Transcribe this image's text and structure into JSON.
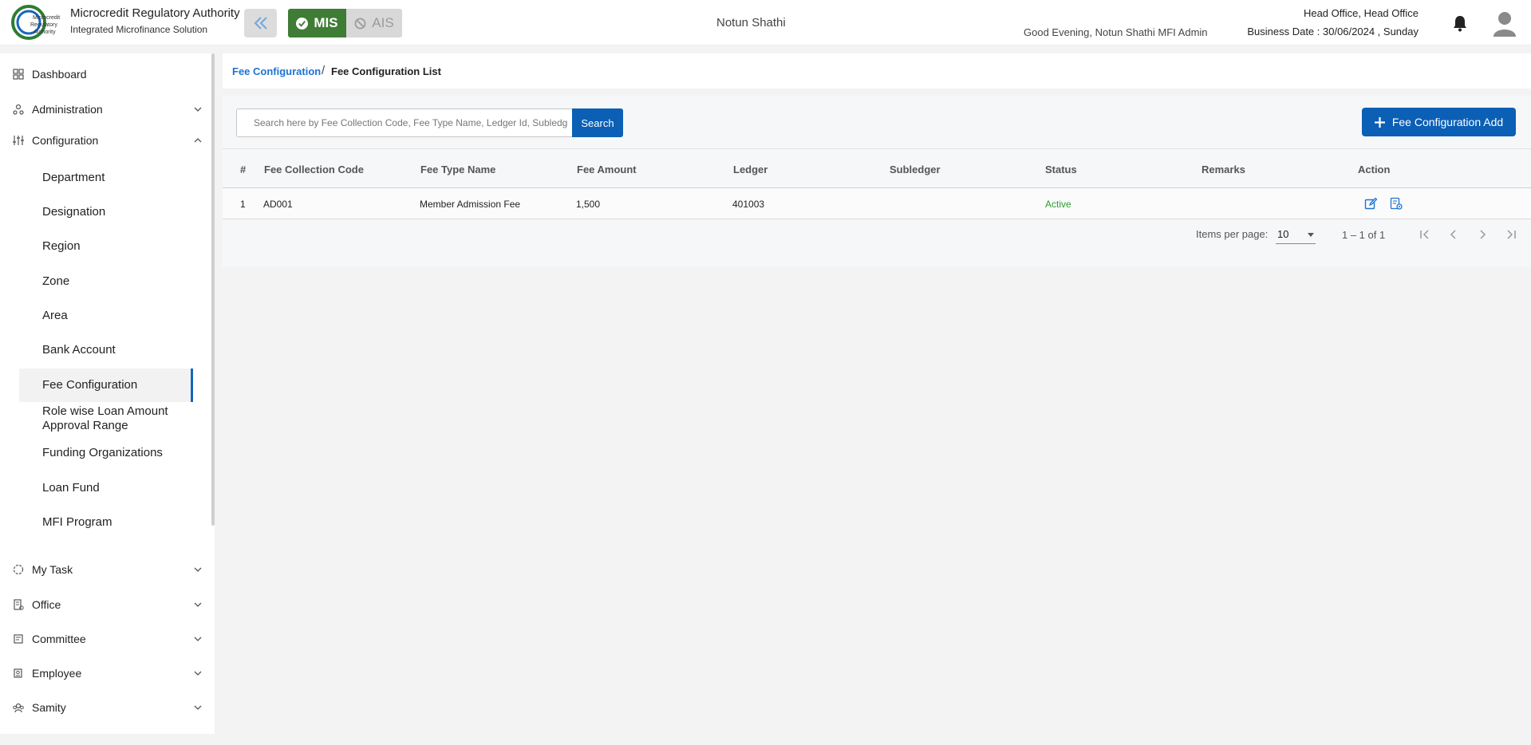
{
  "header": {
    "brand_title": "Microcredit Regulatory Authority",
    "brand_subtitle": "Integrated Microfinance Solution",
    "logo_text": "Microcredit Regulatory Authority",
    "mis_label": "MIS",
    "ais_label": "AIS",
    "organization": "Notun Shathi",
    "greeting": "Good Evening, Notun Shathi MFI Admin",
    "office": "Head Office, Head Office",
    "business_date": "Business Date : 30/06/2024 , Sunday",
    "accent": "#3f7c35"
  },
  "sidebar": {
    "items": [
      {
        "label": "Dashboard",
        "icon": "grid-icon"
      },
      {
        "label": "Administration",
        "icon": "users-icon",
        "expanded": false
      },
      {
        "label": "Configuration",
        "icon": "sliders-icon",
        "expanded": true
      },
      {
        "label": "My Task",
        "icon": "task-icon",
        "expanded": false
      },
      {
        "label": "Office",
        "icon": "office-icon",
        "expanded": false
      },
      {
        "label": "Committee",
        "icon": "committee-icon",
        "expanded": false
      },
      {
        "label": "Employee",
        "icon": "employee-icon",
        "expanded": false
      },
      {
        "label": "Samity",
        "icon": "samity-icon",
        "expanded": false
      }
    ],
    "config_items": [
      "Department",
      "Designation",
      "Region",
      "Zone",
      "Area",
      "Bank Account",
      "Fee Configuration",
      "Role wise Loan Amount Approval Range",
      "Funding Organizations",
      "Loan Fund",
      "MFI Program"
    ],
    "active": "Fee Configuration"
  },
  "breadcrumb": {
    "parent": "Fee Configuration",
    "separator": "/",
    "current": "Fee Configuration List"
  },
  "search": {
    "placeholder": "Search here by Fee Collection Code, Fee Type Name, Ledger Id, Subledger",
    "button_label": "Search"
  },
  "add_button_label": "Fee Configuration Add",
  "table": {
    "columns": [
      "#",
      "Fee Collection Code",
      "Fee Type Name",
      "Fee Amount",
      "Ledger",
      "Subledger",
      "Status",
      "Remarks",
      "Action"
    ],
    "rows": [
      {
        "index": "1",
        "code": "AD001",
        "fee_type": "Member Admission Fee",
        "amount": "1,500",
        "ledger": "401003",
        "subledger": "",
        "status": "Active",
        "remarks": ""
      }
    ]
  },
  "pagination": {
    "items_per_page_label": "Items per page:",
    "items_per_page": "10",
    "range": "1 – 1 of 1"
  }
}
